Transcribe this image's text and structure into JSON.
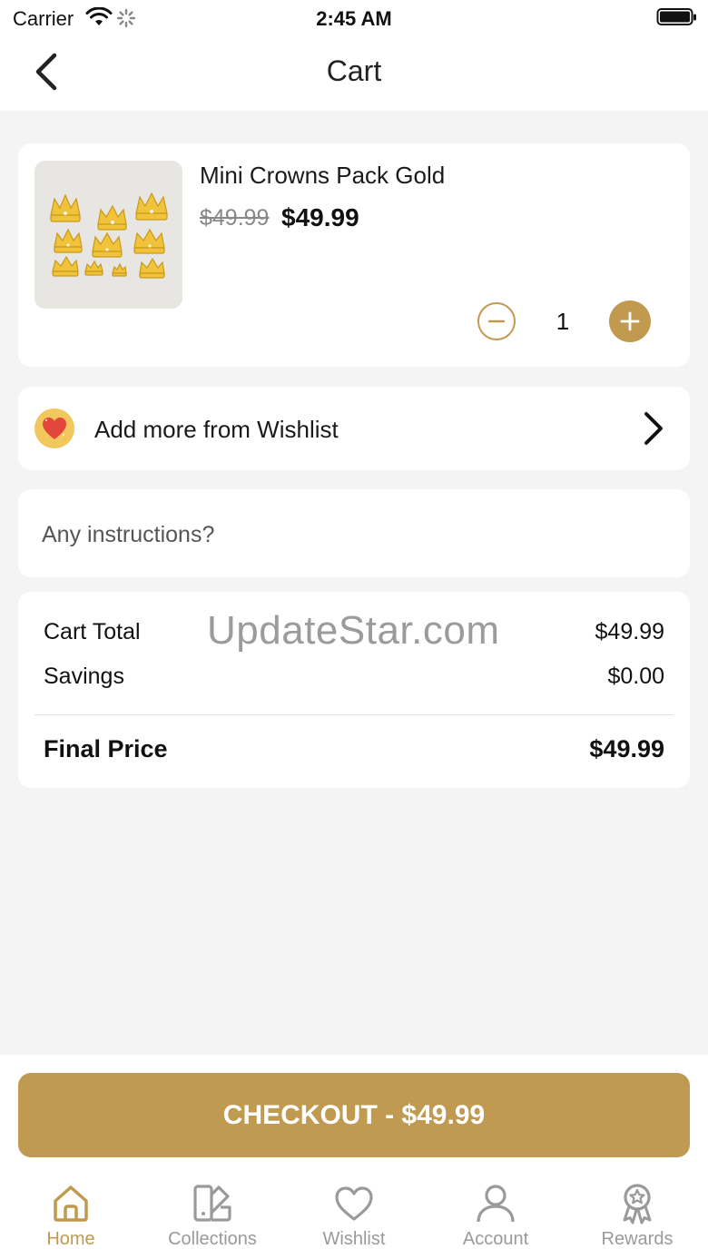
{
  "status_bar": {
    "carrier": "Carrier",
    "time": "2:45 AM"
  },
  "nav": {
    "title": "Cart",
    "back_icon": "chevron-left-icon"
  },
  "cart_item": {
    "name": "Mini Crowns Pack Gold",
    "original_price": "$49.99",
    "price": "$49.99",
    "quantity": "1"
  },
  "wishlist_row": {
    "label": "Add more from Wishlist",
    "icon": "heart-icon"
  },
  "instructions": {
    "placeholder": "Any instructions?"
  },
  "summary": {
    "cart_total_label": "Cart Total",
    "cart_total_value": "$49.99",
    "savings_label": "Savings",
    "savings_value": "$0.00",
    "final_label": "Final Price",
    "final_value": "$49.99",
    "watermark": "UpdateStar.com"
  },
  "checkout": {
    "label": "CHECKOUT - $49.99"
  },
  "tab_bar": {
    "items": [
      {
        "label": "Home",
        "icon": "home-icon",
        "active": true
      },
      {
        "label": "Collections",
        "icon": "collections-icon",
        "active": false
      },
      {
        "label": "Wishlist",
        "icon": "heart-icon",
        "active": false
      },
      {
        "label": "Account",
        "icon": "person-icon",
        "active": false
      },
      {
        "label": "Rewards",
        "icon": "award-icon",
        "active": false
      }
    ]
  },
  "colors": {
    "accent": "#c29a4f",
    "background": "#f4f4f4",
    "card": "#ffffff",
    "inactive_tab": "#9a9a9a"
  }
}
